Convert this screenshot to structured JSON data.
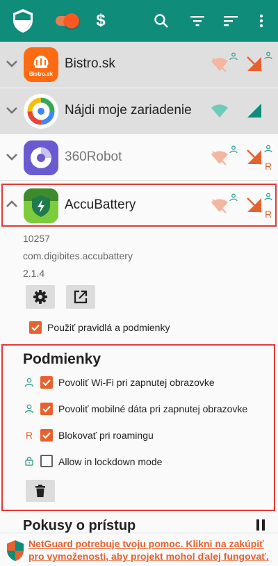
{
  "toolbar": {
    "color": "#0f8c7a",
    "shield_icon": "shield-icon",
    "enabled_toggle": "on",
    "dollar_label": "$"
  },
  "apps": [
    {
      "name": "Bistro.sk",
      "icon_text": "Bistro.sk",
      "expanded": false,
      "wifi_status": "blocked",
      "data_status": "blocked",
      "screen_on_wifi": true,
      "screen_on_data": true,
      "roaming": false
    },
    {
      "name": "Nájdi moje zariadenie",
      "expanded": false,
      "wifi_status": "allowed",
      "data_status": "allowed",
      "roaming": false
    },
    {
      "name": "360Robot",
      "expanded": false,
      "wifi_status": "blocked",
      "data_status": "blocked",
      "screen_on_wifi": true,
      "screen_on_data": true,
      "roaming": true,
      "roaming_label": "R"
    },
    {
      "name": "AccuBattery",
      "expanded": true,
      "wifi_status": "blocked",
      "data_status": "blocked",
      "screen_on_wifi": true,
      "screen_on_data": true,
      "roaming": true,
      "roaming_label": "R"
    }
  ],
  "details": {
    "uid": "10257",
    "package": "com.digibites.accubattery",
    "version": "2.1.4",
    "apply_rules_label": "Použiť pravidlá a podmienky",
    "apply_rules_checked": true
  },
  "conditions": {
    "title": "Podmienky",
    "items": [
      {
        "label": "Povoliť Wi-Fi pri zapnutej obrazovke",
        "checked": true,
        "icon": "person-icon"
      },
      {
        "label": "Povoliť mobilné dáta pri zapnutej obrazovke",
        "checked": true,
        "icon": "person-icon"
      },
      {
        "label": "Blokovať pri roamingu",
        "checked": true,
        "icon": "roaming-r",
        "icon_text": "R"
      },
      {
        "label": "Allow in lockdown mode",
        "checked": false,
        "icon": "lock-icon"
      }
    ]
  },
  "access_attempts": {
    "title": "Pokusy o prístup"
  },
  "banner": {
    "text": "NetGuard potrebuje tvoju pomoc. Klikni na zakúpiť pro vymoženosti, aby projekt mohol ďalej fungovať."
  },
  "colors": {
    "accent": "#e7612e",
    "teal": "#0f8c7a",
    "highlight": "#e53935"
  }
}
